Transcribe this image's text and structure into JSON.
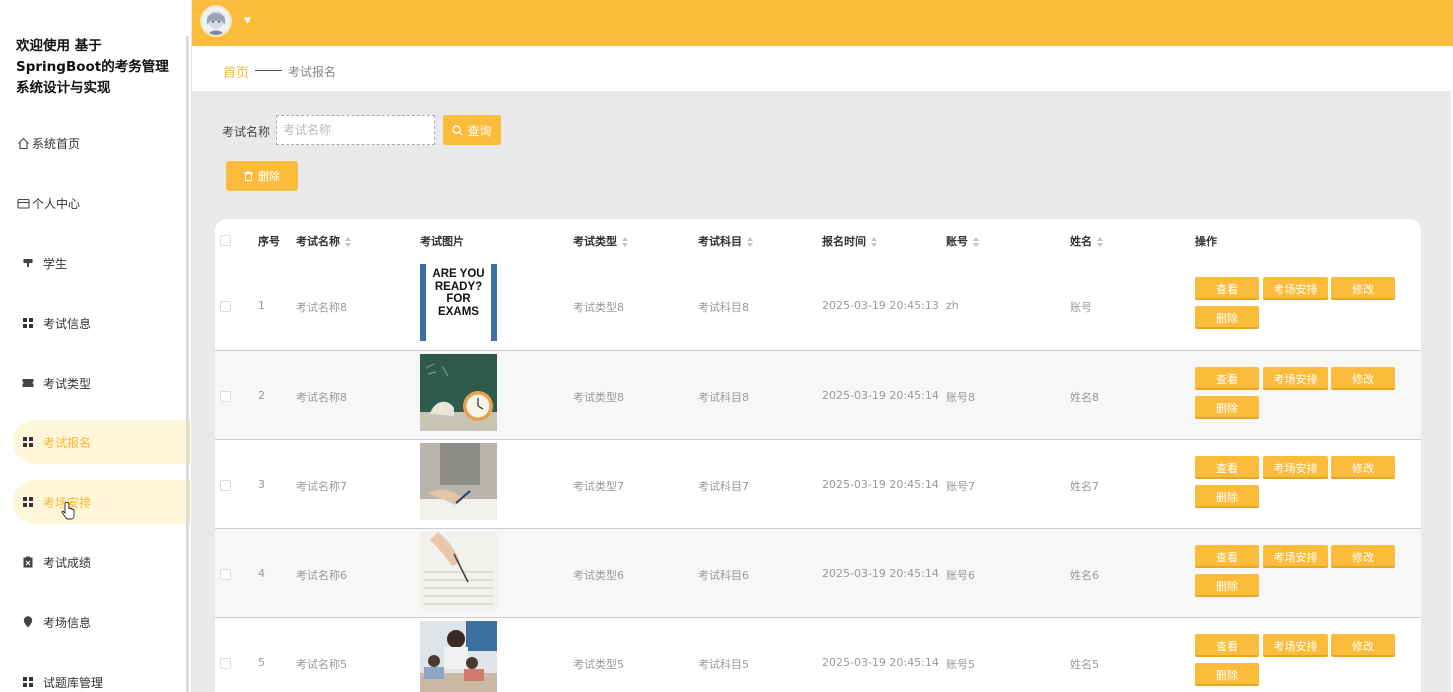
{
  "app": {
    "title": "欢迎使用 基于SpringBoot的考务管理系统设计与实现"
  },
  "sidebar": {
    "items": [
      {
        "label": "系统首页",
        "icon": "home-icon"
      },
      {
        "label": "个人中心",
        "icon": "id-card-icon"
      },
      {
        "label": "学生",
        "icon": "podium-icon"
      },
      {
        "label": "考试信息",
        "icon": "grid-icon"
      },
      {
        "label": "考试类型",
        "icon": "ticket-icon"
      },
      {
        "label": "考试报名",
        "icon": "grid-icon",
        "state": "active"
      },
      {
        "label": "考场安排",
        "icon": "grid-icon",
        "state": "hover"
      },
      {
        "label": "考试成绩",
        "icon": "clipboard-icon"
      },
      {
        "label": "考场信息",
        "icon": "pin-icon"
      },
      {
        "label": "试题库管理",
        "icon": "grid-icon"
      }
    ]
  },
  "breadcrumb": {
    "home": "首页",
    "current": "考试报名"
  },
  "search": {
    "label": "考试名称",
    "placeholder": "考试名称",
    "value": "",
    "query_label": "查询"
  },
  "toolbar": {
    "delete_label": "删除"
  },
  "table": {
    "headers": {
      "index": "序号",
      "exam_name": "考试名称",
      "exam_image": "考试图片",
      "exam_type": "考试类型",
      "exam_subject": "考试科目",
      "signup_time": "报名时间",
      "account": "账号",
      "name": "姓名",
      "actions": "操作"
    },
    "action_labels": {
      "view": "查看",
      "arrange": "考场安排",
      "edit": "修改",
      "delete": "删除"
    },
    "rows": [
      {
        "index": "1",
        "exam_name": "考试名称8",
        "image_text": "ARE YOU READY? FOR EXAMS",
        "exam_type": "考试类型8",
        "exam_subject": "考试科目8",
        "signup_time": "2025-03-19 20:45:13",
        "account": "zh",
        "name": "账号"
      },
      {
        "index": "2",
        "exam_name": "考试名称8",
        "exam_type": "考试类型8",
        "exam_subject": "考试科目8",
        "signup_time": "2025-03-19 20:45:14",
        "account": "账号8",
        "name": "姓名8"
      },
      {
        "index": "3",
        "exam_name": "考试名称7",
        "exam_type": "考试类型7",
        "exam_subject": "考试科目7",
        "signup_time": "2025-03-19 20:45:14",
        "account": "账号7",
        "name": "姓名7"
      },
      {
        "index": "4",
        "exam_name": "考试名称6",
        "exam_type": "考试类型6",
        "exam_subject": "考试科目6",
        "signup_time": "2025-03-19 20:45:14",
        "account": "账号6",
        "name": "姓名6"
      },
      {
        "index": "5",
        "exam_name": "考试名称5",
        "exam_type": "考试类型5",
        "exam_subject": "考试科目5",
        "signup_time": "2025-03-19 20:45:14",
        "account": "账号5",
        "name": "姓名5"
      }
    ]
  },
  "colors": {
    "accent": "#fbbc3c",
    "active_bg": "#fff6d9",
    "active_text": "#f7b92e"
  }
}
